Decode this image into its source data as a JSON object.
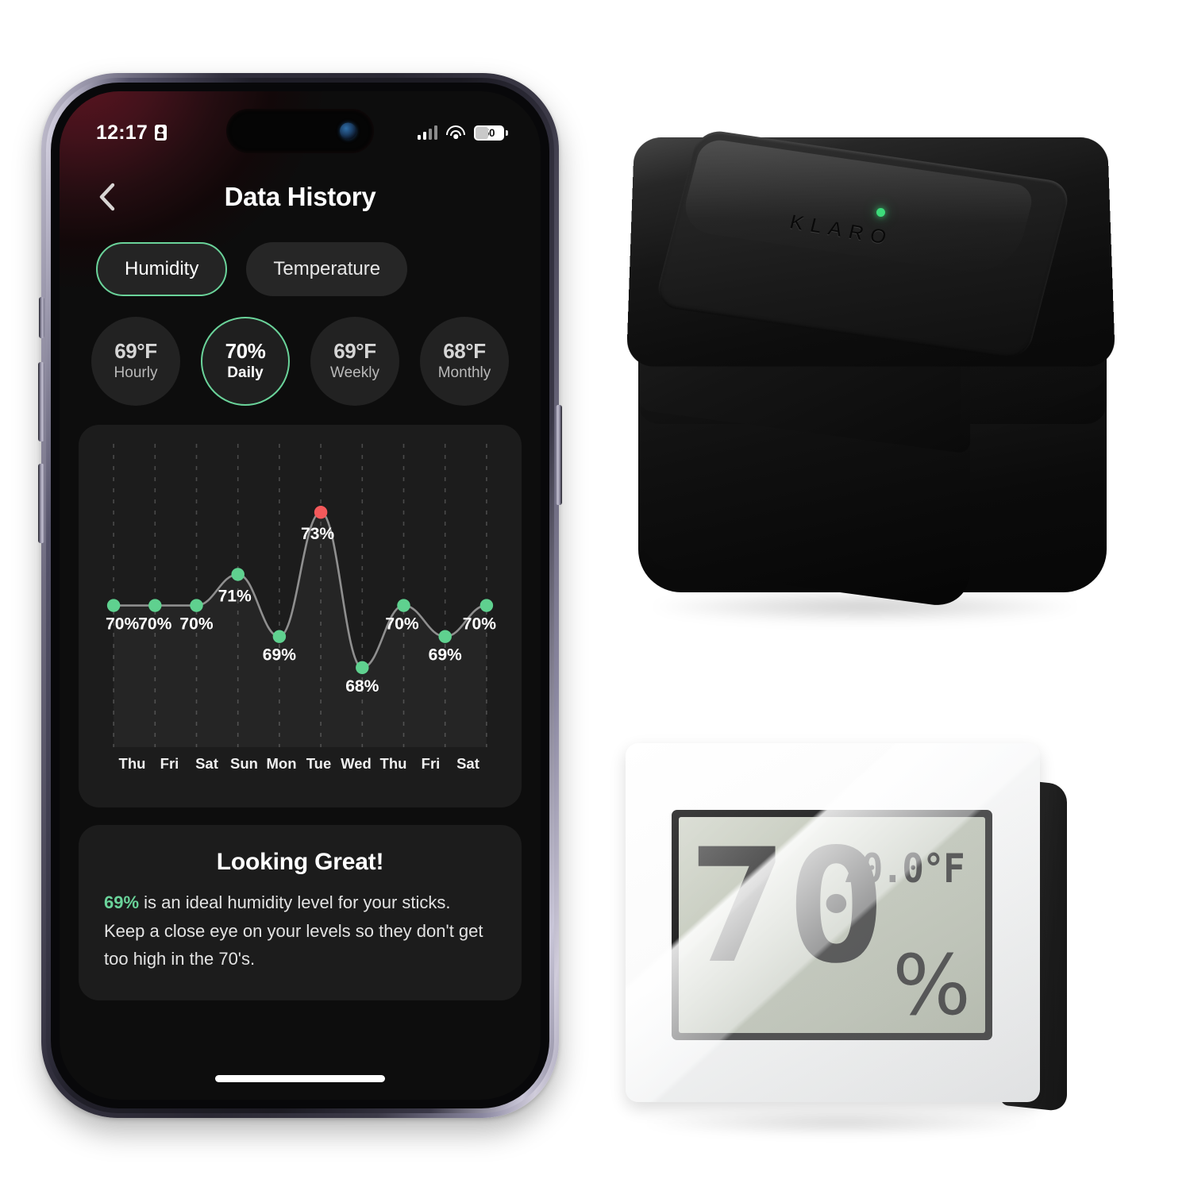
{
  "phone": {
    "status_bar": {
      "time": "12:17",
      "lock_icon": "lock-portrait-icon",
      "signal_icon": "cellular-signal-icon",
      "wifi_icon": "wifi-icon",
      "battery_level": "50"
    },
    "nav": {
      "back_icon": "chevron-left-icon",
      "title": "Data History"
    },
    "tabs": [
      {
        "label": "Humidity",
        "active": true
      },
      {
        "label": "Temperature",
        "active": false
      }
    ],
    "metrics": [
      {
        "value": "69°F",
        "label": "Hourly",
        "active": false
      },
      {
        "value": "70%",
        "label": "Daily",
        "active": true
      },
      {
        "value": "69°F",
        "label": "Weekly",
        "active": false
      },
      {
        "value": "68°F",
        "label": "Monthly",
        "active": false
      }
    ],
    "tip": {
      "title": "Looking Great!",
      "highlight": "69%",
      "body": " is an ideal humidity level for your sticks. Keep a close eye on your levels so they don't get too high in the 70's."
    },
    "home_indicator": "home-indicator"
  },
  "chart_data": {
    "type": "line",
    "title": "Data History",
    "xlabel": "",
    "ylabel": "",
    "ylim": [
      66,
      75
    ],
    "grid": "vertical-dashed",
    "legend": "none",
    "categories": [
      "Thu",
      "Fri",
      "Sat",
      "Sun",
      "Mon",
      "Tue",
      "Wed",
      "Thu",
      "Fri",
      "Sat"
    ],
    "values": [
      70,
      70,
      70,
      71,
      69,
      73,
      68,
      70,
      69,
      70
    ],
    "point_labels": [
      "70%",
      "70%",
      "70%",
      "71%",
      "69%",
      "73%",
      "68%",
      "70%",
      "69%",
      "70%"
    ],
    "point_colors": [
      "#5fd18f",
      "#5fd18f",
      "#5fd18f",
      "#5fd18f",
      "#5fd18f",
      "#f4595b",
      "#5fd18f",
      "#5fd18f",
      "#5fd18f",
      "#5fd18f"
    ],
    "series": [
      {
        "name": "Humidity",
        "values": [
          70,
          70,
          70,
          71,
          69,
          73,
          68,
          70,
          69,
          70
        ],
        "unit": "%"
      }
    ]
  },
  "klaro_sensor": {
    "brand": "KLARO",
    "led": "status-led-green"
  },
  "hygrometer": {
    "humidity": "70",
    "temperature": "70.0°F",
    "unit_symbol": "%"
  },
  "colors": {
    "accent_green": "#6ad39a",
    "point_green": "#5fd18f",
    "alert_red": "#f4595b",
    "card_bg": "#1c1c1c",
    "screen_bg": "#0d0d0d",
    "led_green": "#3ddb7a"
  }
}
